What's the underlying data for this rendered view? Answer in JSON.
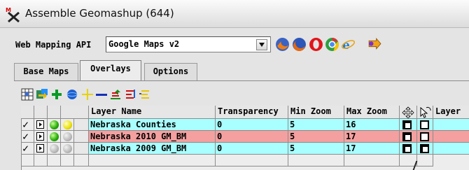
{
  "window": {
    "title": "Assemble Geomashup (644)",
    "icon": "geomashup-app-icon"
  },
  "api": {
    "label": "Web Mapping API",
    "selected": "Google Maps v2",
    "browser_icons": [
      "firefox-icon",
      "firefox-globe-icon",
      "opera-icon",
      "chrome-icon",
      "internet-explorer-icon",
      "export-arrow-icon"
    ]
  },
  "tabs": [
    {
      "label": "Base Maps",
      "active": false
    },
    {
      "label": "Overlays",
      "active": true
    },
    {
      "label": "Options",
      "active": false
    }
  ],
  "toolbar": {
    "icons": [
      "grid-icon",
      "import-icon",
      "add-layer-icon",
      "globe-icon",
      "add-icon",
      "remove-icon",
      "move-up-icon",
      "sort-icon",
      "move-down-icon"
    ]
  },
  "table": {
    "headers": {
      "layer_name": "Layer Name",
      "transparency": "Transparency",
      "min_zoom": "Min Zoom",
      "max_zoom": "Max Zoom",
      "layer": "Layer"
    },
    "rows": [
      {
        "name": "Nebraska Counties",
        "transparency": "0",
        "min_zoom": "5",
        "max_zoom": "16",
        "color": "#a9ffff",
        "status1": "green",
        "status2": "yellow",
        "check": "✓"
      },
      {
        "name": "Nebraska 2010 GM_BM",
        "transparency": "0",
        "min_zoom": "5",
        "max_zoom": "17",
        "color": "#f4a0a0",
        "status1": "green",
        "status2": "gray",
        "check": "✓"
      },
      {
        "name": "Nebraska 2009 GM_BM",
        "transparency": "0",
        "min_zoom": "5",
        "max_zoom": "17",
        "color": "#a9ffff",
        "status1": "gray",
        "status2": "gray",
        "check": "✓"
      }
    ]
  }
}
